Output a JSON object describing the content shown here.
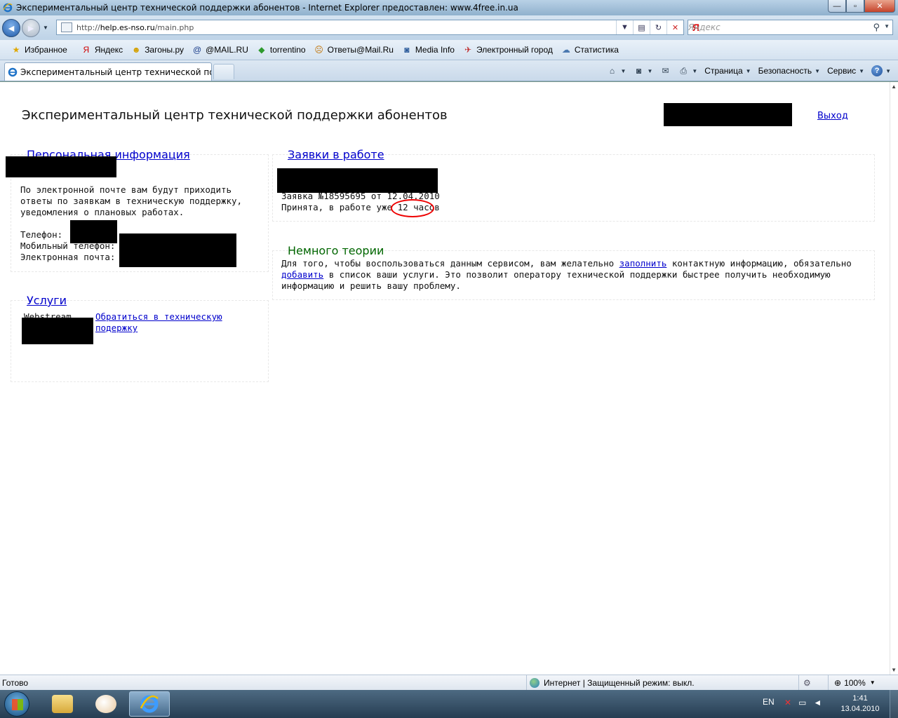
{
  "window": {
    "title": "Экспериментальный центр технической поддержки абонентов - Internet Explorer предоставлен: www.4free.in.ua",
    "min_glyph": "—",
    "max_glyph": "▫",
    "close_glyph": "✕"
  },
  "navbar": {
    "back_glyph": "◄",
    "forward_glyph": "►",
    "dropdown_glyph": "▼",
    "url_prefix": "http://",
    "url_host": "help.es-nso.ru",
    "url_path": "/main.php",
    "search_placeholder": "Яндекс",
    "search_logo": "Я",
    "search_glyph": "⚲"
  },
  "favorites": {
    "main_label": "Избранное",
    "items": [
      {
        "label": "Яндекс",
        "icon": "yandex-icon",
        "glyph": "Я",
        "color": "#d00000"
      },
      {
        "label": "Загоны.ру",
        "icon": "smiley-icon",
        "glyph": "☻",
        "color": "#d4a000"
      },
      {
        "label": "@MAIL.RU",
        "icon": "at-icon",
        "glyph": "@",
        "color": "#1a3d8a"
      },
      {
        "label": "torrentino",
        "icon": "torrentino-icon",
        "glyph": "◆",
        "color": "#2e9a2e"
      },
      {
        "label": "Ответы@Mail.Ru",
        "icon": "answers-icon",
        "glyph": "☹",
        "color": "#c07000"
      },
      {
        "label": "Media Info",
        "icon": "media-info-icon",
        "glyph": "◙",
        "color": "#2a5a9a"
      },
      {
        "label": "Электронный город",
        "icon": "city-icon",
        "glyph": "✈",
        "color": "#c03030"
      },
      {
        "label": "Статистика",
        "icon": "stats-icon",
        "glyph": "☁",
        "color": "#4a78b0"
      }
    ]
  },
  "tabs": {
    "active_label": "Экспериментальный центр технической подде..."
  },
  "commandbar": {
    "home_glyph": "⌂",
    "feeds_glyph": "◙",
    "mail_glyph": "✉",
    "print_glyph": "⎙",
    "page_label": "Страница",
    "safety_label": "Безопасность",
    "tools_label": "Сервис",
    "help_glyph": "?"
  },
  "page": {
    "title": "Экспериментальный центр технической поддержки абонентов",
    "logout_label": "Выход",
    "personal": {
      "heading": "Персональная информация",
      "email_note_1": "По электронной почте вам будут приходить",
      "email_note_2": "ответы по заявкам в техническую поддержку,",
      "email_note_3": "уведомления о плановых работах.",
      "phone_label": "Телефон:",
      "mobile_label": "Мобильный телефон: 8",
      "email_label": "Электронная почта:"
    },
    "services": {
      "heading": "Услуги",
      "service_name": "Webstream",
      "support_link_1": "Обратиться в техническую",
      "support_link_2": "подержку"
    },
    "requests": {
      "heading": "Заявки в работе",
      "request_line": "Заявка №18595695 от 12.04.2010",
      "status_prefix": "Принята, в работе уже ",
      "status_hours": "12 часов"
    },
    "theory": {
      "heading": "Немного теории",
      "line1_before": "Для того, чтобы воспользоваться данным сервисом, вам желательно ",
      "fill_link": "заполнить",
      "line1_after": " контактную информацию, обязательно",
      "add_link": "добавить",
      "line2_after": " в список ваши услуги. Это позволит оператору технической поддержки быстрее получить необходимую",
      "line3": "информацию и решить вашу проблему."
    }
  },
  "statusbar": {
    "ready": "Готово",
    "zone": "Интернет | Защищенный режим: выкл.",
    "zoom": "100%",
    "zoom_glyph": "⊕",
    "lock_glyph": "⚙"
  },
  "taskbar": {
    "lang": "EN",
    "time": "1:41",
    "date": "13.04.2010",
    "net_glyph": "✕",
    "tray_glyph": "▭",
    "volume_glyph": "◄"
  },
  "colors": {
    "link": "#0000cc",
    "heading_green": "#006600",
    "highlight_circle": "#e00000"
  }
}
